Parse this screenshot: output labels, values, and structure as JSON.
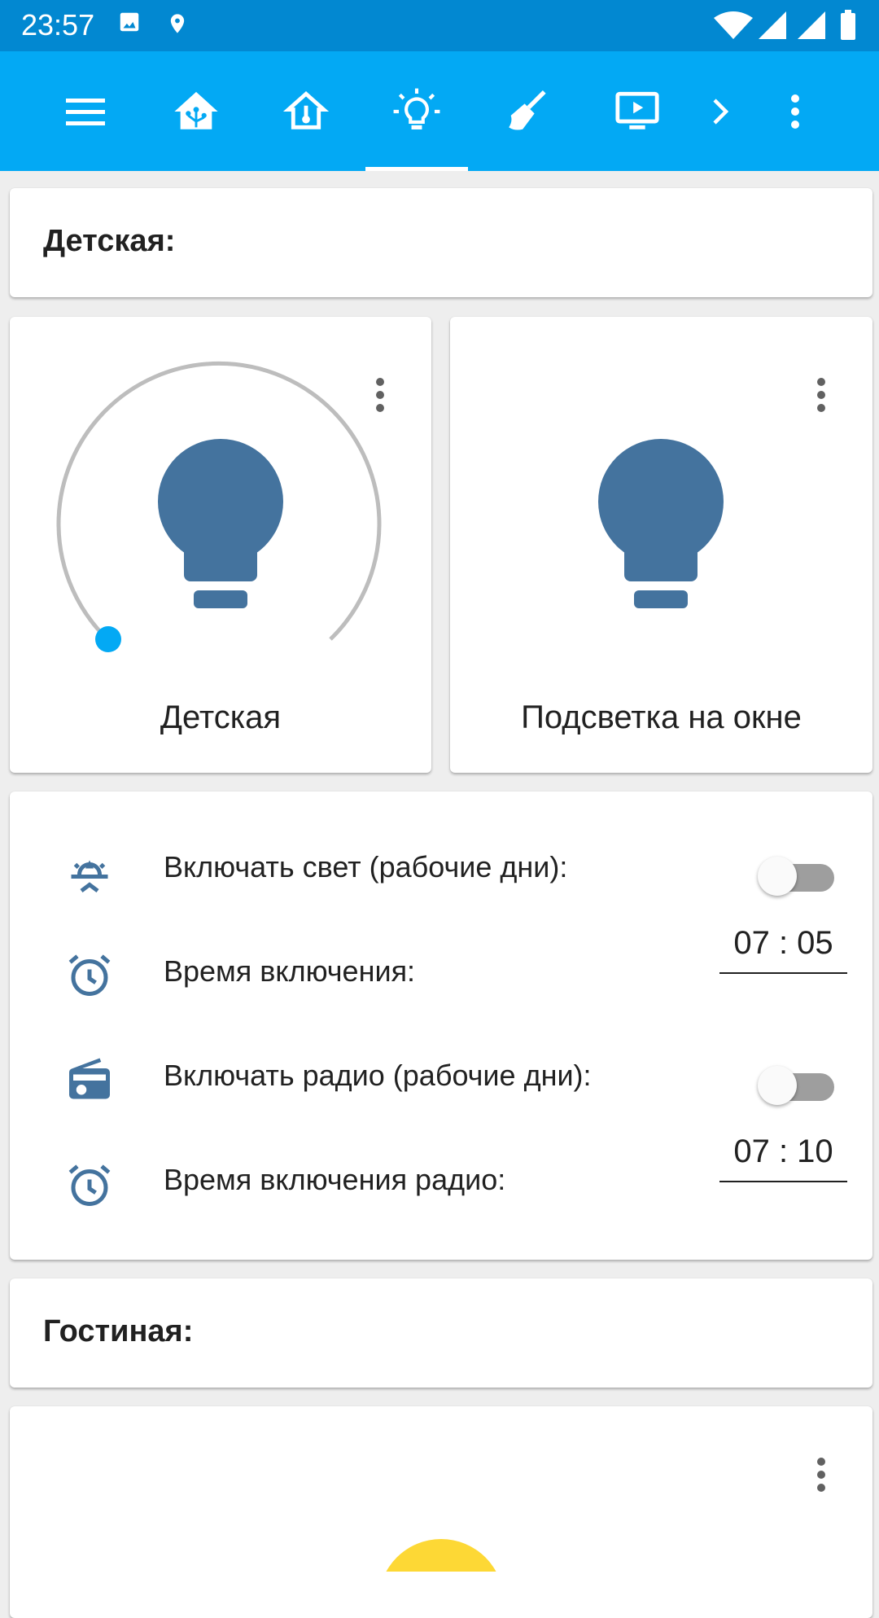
{
  "status_bar": {
    "time": "23:57"
  },
  "toolbar": {
    "icons": [
      "menu-icon",
      "home-assistant-icon",
      "home-thermometer-icon",
      "lightbulb-on-icon",
      "broom-icon",
      "television-play-icon",
      "chevron-right-icon",
      "overflow-menu-icon"
    ],
    "active_tab": "lightbulb-on-icon"
  },
  "sections": {
    "detskaya_title": "Детская:",
    "gostinaya_title": "Гостиная:"
  },
  "lights": [
    {
      "name": "Детская",
      "brightness_level": 0.0,
      "color": "#44739e"
    },
    {
      "name": "Подсветка на окне",
      "color": "#44739e"
    }
  ],
  "automation": {
    "rows": [
      {
        "icon": "sun-rise-icon",
        "label": "Включать свет (рабочие дни):"
      },
      {
        "icon": "alarm-clock-icon",
        "label": "Время включения:",
        "hour": "07",
        "minute": "05"
      },
      {
        "icon": "radio-icon",
        "label": "Включать радио (рабочие дни):"
      },
      {
        "icon": "alarm-clock-icon",
        "label": "Время включения радио:",
        "hour": "07",
        "minute": "10"
      }
    ]
  },
  "colors": {
    "status_bar": "#0288d1",
    "toolbar": "#03a9f4",
    "icon": "#44739e",
    "slider_accent": "#03a9f4",
    "light_on": "#fdd835"
  }
}
